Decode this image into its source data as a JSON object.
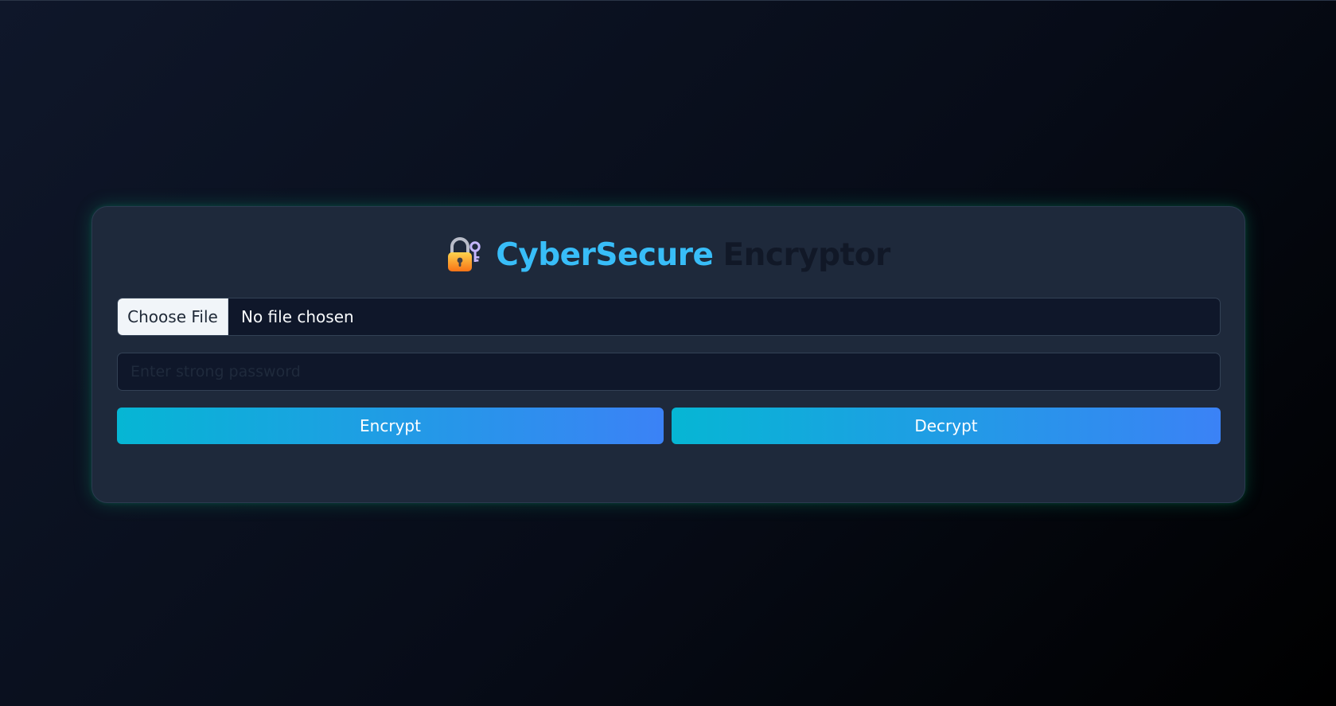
{
  "header": {
    "title_accent": "CyberSecure",
    "title_rest": "Encryptor",
    "icon": "lock-with-key-icon"
  },
  "file_input": {
    "button_label": "Choose File",
    "status": "No file chosen"
  },
  "password": {
    "placeholder": "Enter strong password",
    "value": ""
  },
  "actions": {
    "encrypt_label": "Encrypt",
    "decrypt_label": "Decrypt"
  },
  "colors": {
    "accent": "#38bdf8",
    "button_gradient_start": "#06b6d4",
    "button_gradient_end": "#3b82f6",
    "card_glow": "#10b981",
    "card_background": "#1e293b"
  }
}
